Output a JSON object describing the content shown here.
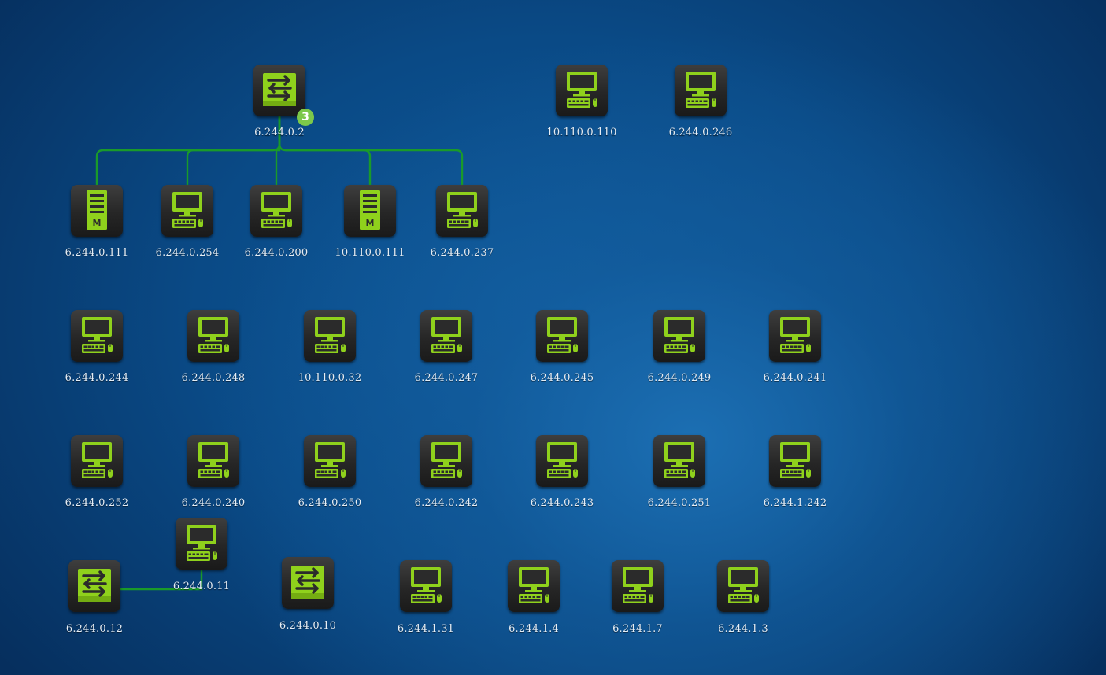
{
  "colors": {
    "icon": "#8fd11c",
    "link": "#1a9a2a",
    "badge": "#7cc84a"
  },
  "badge_count": "3",
  "nodes": [
    {
      "id": "n0",
      "label": "6.244.0.2",
      "icon": "switch"
    },
    {
      "id": "n1",
      "label": "10.110.0.110",
      "icon": "pc"
    },
    {
      "id": "n2",
      "label": "6.244.0.246",
      "icon": "pc"
    },
    {
      "id": "n3",
      "label": "6.244.0.111",
      "icon": "server"
    },
    {
      "id": "n4",
      "label": "6.244.0.254",
      "icon": "pc"
    },
    {
      "id": "n5",
      "label": "6.244.0.200",
      "icon": "pc"
    },
    {
      "id": "n6",
      "label": "10.110.0.111",
      "icon": "server"
    },
    {
      "id": "n7",
      "label": "6.244.0.237",
      "icon": "pc"
    },
    {
      "id": "n8",
      "label": "6.244.0.244",
      "icon": "pc"
    },
    {
      "id": "n9",
      "label": "6.244.0.248",
      "icon": "pc"
    },
    {
      "id": "n10",
      "label": "10.110.0.32",
      "icon": "pc"
    },
    {
      "id": "n11",
      "label": "6.244.0.247",
      "icon": "pc"
    },
    {
      "id": "n12",
      "label": "6.244.0.245",
      "icon": "pc"
    },
    {
      "id": "n13",
      "label": "6.244.0.249",
      "icon": "pc"
    },
    {
      "id": "n14",
      "label": "6.244.0.241",
      "icon": "pc"
    },
    {
      "id": "n15",
      "label": "6.244.0.252",
      "icon": "pc"
    },
    {
      "id": "n16",
      "label": "6.244.0.240",
      "icon": "pc"
    },
    {
      "id": "n17",
      "label": "6.244.0.250",
      "icon": "pc"
    },
    {
      "id": "n18",
      "label": "6.244.0.242",
      "icon": "pc"
    },
    {
      "id": "n19",
      "label": "6.244.0.243",
      "icon": "pc"
    },
    {
      "id": "n20",
      "label": "6.244.0.251",
      "icon": "pc"
    },
    {
      "id": "n21",
      "label": "6.244.1.242",
      "icon": "pc"
    },
    {
      "id": "n22",
      "label": "6.244.0.11",
      "icon": "pc"
    },
    {
      "id": "n23",
      "label": "6.244.0.12",
      "icon": "switch"
    },
    {
      "id": "n24",
      "label": "6.244.0.10",
      "icon": "switch"
    },
    {
      "id": "n25",
      "label": "6.244.1.31",
      "icon": "pc"
    },
    {
      "id": "n26",
      "label": "6.244.1.4",
      "icon": "pc"
    },
    {
      "id": "n27",
      "label": "6.244.1.7",
      "icon": "pc"
    },
    {
      "id": "n28",
      "label": "6.244.1.3",
      "icon": "pc"
    }
  ],
  "links": [
    {
      "from": "n0",
      "to": "n3"
    },
    {
      "from": "n0",
      "to": "n4"
    },
    {
      "from": "n0",
      "to": "n5"
    },
    {
      "from": "n0",
      "to": "n6"
    },
    {
      "from": "n0",
      "to": "n7"
    },
    {
      "from": "n23",
      "to": "n22"
    }
  ]
}
